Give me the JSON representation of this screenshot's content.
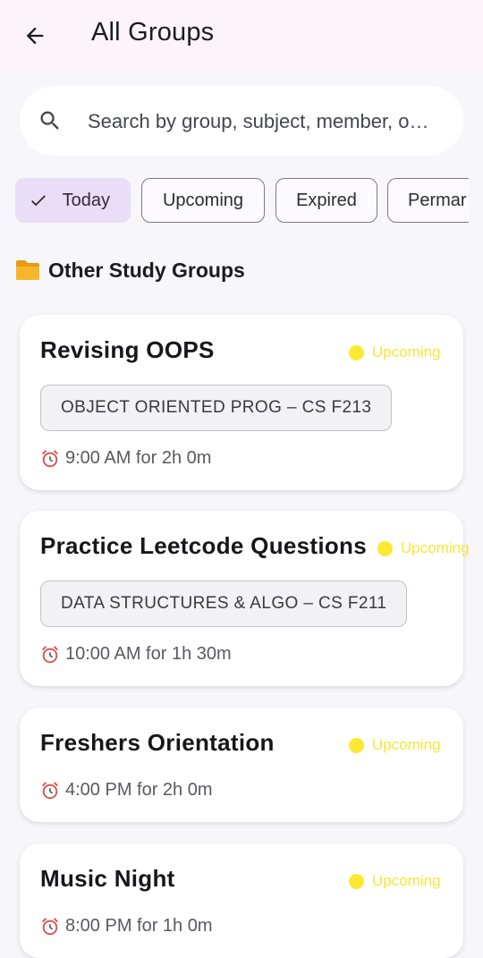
{
  "header": {
    "title": "All Groups",
    "back_icon": "arrow-back-icon"
  },
  "search": {
    "placeholder": "Search by group, subject, member, o…",
    "icon": "search-icon"
  },
  "filters": [
    {
      "label": "Today",
      "selected": true
    },
    {
      "label": "Upcoming",
      "selected": false
    },
    {
      "label": "Expired",
      "selected": false
    },
    {
      "label": "Permar",
      "selected": false
    }
  ],
  "section": {
    "emoji": "📁",
    "title": "Other Study Groups"
  },
  "groups": [
    {
      "title": "Revising OOPS",
      "status": "Upcoming",
      "subject": "OBJECT ORIENTED PROG – CS F213",
      "time": "9:00 AM for 2h 0m"
    },
    {
      "title": "Practice Leetcode Questions",
      "status": "Upcoming",
      "subject": "DATA STRUCTURES & ALGO – CS F211",
      "time": "10:00 AM for 1h 30m"
    },
    {
      "title": "Freshers Orientation",
      "status": "Upcoming",
      "subject": "",
      "time": "4:00 PM for 2h 0m"
    },
    {
      "title": "Music Night",
      "status": "Upcoming",
      "subject": "",
      "time": "8:00 PM for 1h 0m"
    }
  ],
  "colors": {
    "appbar": "#fcf3fb",
    "selected_chip": "#e8def8",
    "status_dot": "#fbe934",
    "status_text": "#f5e63a"
  }
}
